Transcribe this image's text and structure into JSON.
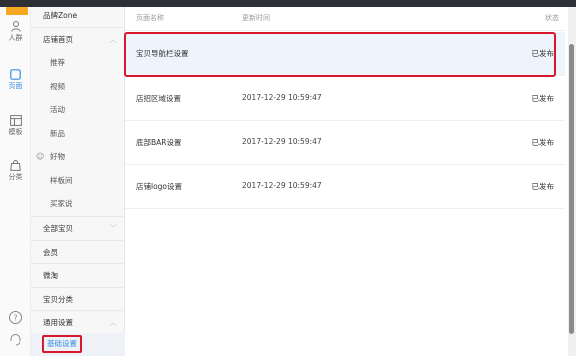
{
  "rail": {
    "items": [
      {
        "label": "人群",
        "icon": "person-icon"
      },
      {
        "label": "页面",
        "icon": "page-icon",
        "active": true
      },
      {
        "label": "模板",
        "icon": "template-icon"
      },
      {
        "label": "分类",
        "icon": "bag-icon"
      }
    ],
    "bottom_icons": [
      "help-icon",
      "headset-icon"
    ]
  },
  "menu": {
    "brand_zone": "品牌Zone",
    "store_home": "店铺首页",
    "store_home_sub": [
      "推荐",
      "视频",
      "活动",
      "新品",
      "好物",
      "样板间",
      "买家说"
    ],
    "all_items": "全部宝贝",
    "member": "会员",
    "weitao": "微淘",
    "item_category": "宝贝分类",
    "general_settings": "通用设置",
    "basic_settings": "基础设置"
  },
  "table": {
    "headers": {
      "name": "页面名称",
      "updated": "更新时间",
      "status": "状态"
    },
    "rows": [
      {
        "name": "宝贝导航栏设置",
        "updated": "",
        "status": "已发布"
      },
      {
        "name": "店招区域设置",
        "updated": "2017-12-29 10:59:47",
        "status": "已发布"
      },
      {
        "name": "底部BAR设置",
        "updated": "2017-12-29 10:59:47",
        "status": "已发布"
      },
      {
        "name": "店铺logo设置",
        "updated": "2017-12-29 10:59:47",
        "status": "已发布"
      }
    ]
  },
  "colors": {
    "highlight_border": "#d8182c",
    "accent": "#3a8ee6",
    "topbar": "#2f3036"
  }
}
